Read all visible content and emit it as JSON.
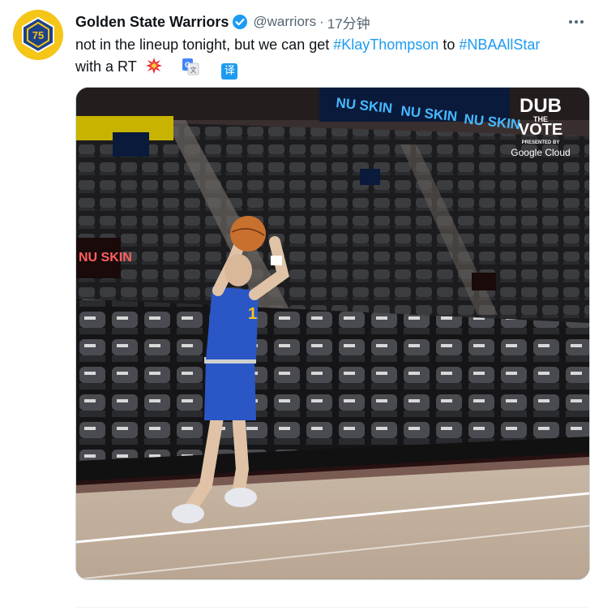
{
  "tweet": {
    "display_name": "Golden State Warriors",
    "handle": "@warriors",
    "separator": "·",
    "time": "17分钟",
    "text_part1": "not in the lineup tonight, but we can get ",
    "hashtag1": "#KlayThompson",
    "text_part2": " to ",
    "hashtag2": "#NBAAllStar",
    "text_part3": "with a RT",
    "translate_label": "译"
  },
  "media": {
    "sponsor_banner": "NU SKIN",
    "overlay_line1": "DUB",
    "overlay_line2": "THE",
    "overlay_line3": "VOTE",
    "overlay_presented": "PRESENTED BY",
    "overlay_sponsor": "Google Cloud"
  },
  "colors": {
    "link": "#1d9bf0",
    "secondary_text": "#536471",
    "avatar_bg": "#f5c518",
    "jersey_blue": "#2a56c6"
  }
}
